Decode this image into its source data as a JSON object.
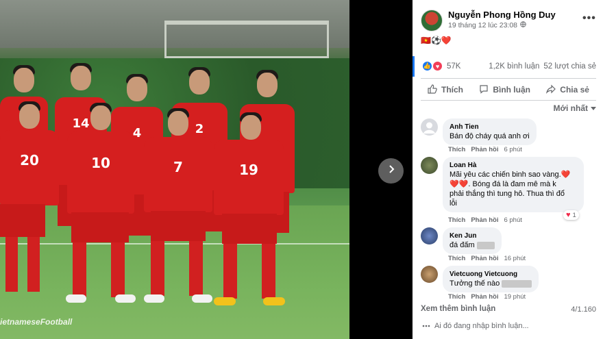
{
  "photo": {
    "watermark": "ietnameseFootball",
    "jerseys_back": [
      "14",
      "4",
      "2"
    ],
    "jerseys_front": [
      "20",
      "10",
      "7",
      "19"
    ]
  },
  "post": {
    "author": "Nguyễn Phong Hồng Duy",
    "time": "19 tháng 12 lúc 23:08",
    "text": "🇻🇳⚽❤️",
    "reaction_count": "57K",
    "comments_count": "1,2K bình luận",
    "shares_count": "52 lượt chia sẻ"
  },
  "actions": {
    "like": "Thích",
    "comment": "Bình luận",
    "share": "Chia sẻ"
  },
  "sort_label": "Mới nhất",
  "comments": [
    {
      "name": "Anh Tien",
      "lines": [
        "Bán độ cháy quá anh ơi"
      ],
      "like": "Thích",
      "reply": "Phản hồi",
      "time": "6 phút"
    },
    {
      "name": "Loan Hà",
      "lines": [
        "Mãi yêu các chiến binh sao vàng.❤️",
        "❤️❤️. Bóng đá là đam mê mà k",
        "phải thắng thì tung hô. Thua thì đổ",
        "lỗi"
      ],
      "like": "Thích",
      "reply": "Phản hồi",
      "time": "6 phút",
      "reactions": "1"
    },
    {
      "name": "Ken Jun",
      "lines": [
        "đá đấm"
      ],
      "like": "Thích",
      "reply": "Phản hồi",
      "time": "16 phút"
    },
    {
      "name": "Vietcuong Vietcuong",
      "lines": [
        "Tưởng thế nào"
      ],
      "like": "Thích",
      "reply": "Phản hồi",
      "time": "19 phút"
    }
  ],
  "see_more": "Xem thêm bình luận",
  "pager": "4/1.160",
  "typing": "Ai đó đang nhập bình luận..."
}
